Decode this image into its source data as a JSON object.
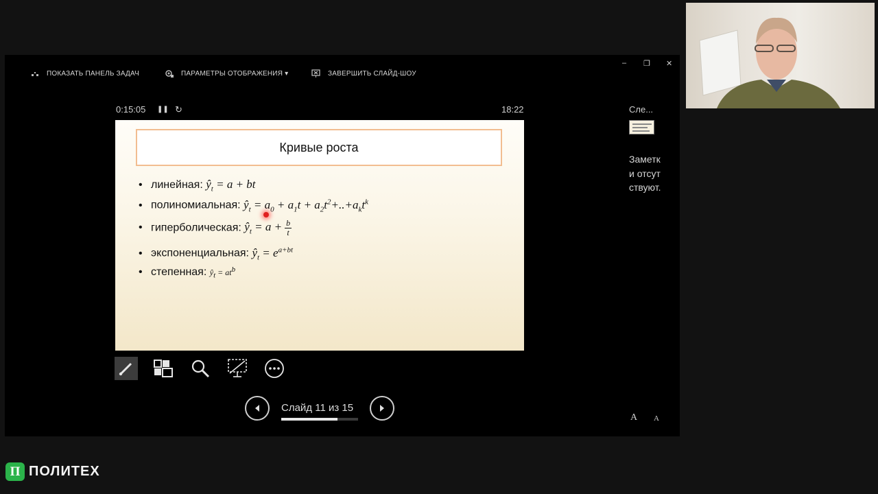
{
  "toolbar": {
    "show_taskbar": "ПОКАЗАТЬ ПАНЕЛЬ ЗАДАЧ",
    "display_settings": "ПАРАМЕТРЫ ОТОБРАЖЕНИЯ ▾",
    "end_show": "ЗАВЕРШИТЬ СЛАЙД-ШОУ"
  },
  "window_controls": {
    "minimize": "–",
    "restore": "❐",
    "close": "✕"
  },
  "timer": {
    "elapsed": "0:15:05",
    "clock": "18:22",
    "pause_icon": "❚❚",
    "reset_icon": "↻"
  },
  "slide": {
    "title": "Кривые роста",
    "bullets": [
      {
        "label": "линейная: "
      },
      {
        "label": "полиномиальная: "
      },
      {
        "label": "гиперболическая: "
      },
      {
        "label": "экспоненциальная: "
      },
      {
        "label": "степенная: "
      }
    ]
  },
  "navigation": {
    "counter": "Слайд 11 из 15",
    "progress": 0.733
  },
  "next_panel": {
    "label": "Сле...",
    "notes": "Заметки отсутствуют."
  },
  "font_controls": {
    "increase": "A",
    "decrease": "A"
  },
  "logo": {
    "mark": "П",
    "text": "ПОЛИТЕХ"
  }
}
